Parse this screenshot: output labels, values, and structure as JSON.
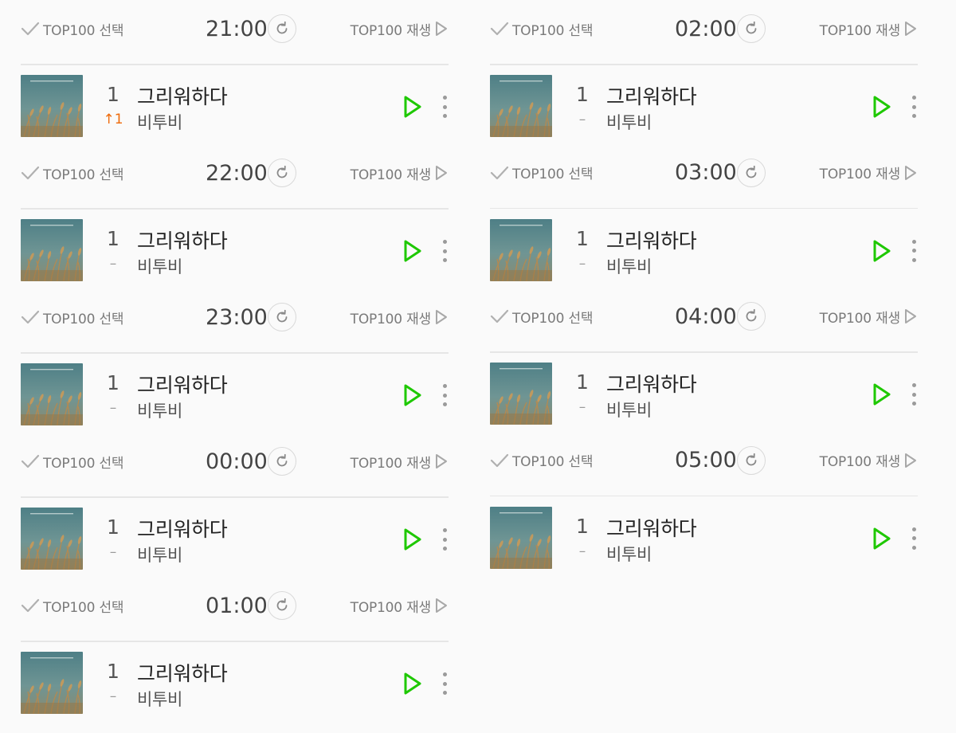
{
  "labels": {
    "select": "TOP100 선택",
    "play_all": "TOP100 재생"
  },
  "icons": {
    "check": "check-icon",
    "refresh": "refresh-icon",
    "play_outline": "play-outline-icon",
    "play": "play-icon",
    "more": "more-vertical-icon"
  },
  "colors": {
    "play_green": "#1ec800",
    "rank_up": "#ee6b0b",
    "muted": "#9a9a9a"
  },
  "left_column": [
    {
      "time": "21:00",
      "rank": "1",
      "rank_change": "↑1",
      "rank_change_type": "up",
      "title": "그리워하다",
      "artist": "비투비"
    },
    {
      "time": "22:00",
      "rank": "1",
      "rank_change": "–",
      "rank_change_type": "same",
      "title": "그리워하다",
      "artist": "비투비"
    },
    {
      "time": "23:00",
      "rank": "1",
      "rank_change": "–",
      "rank_change_type": "same",
      "title": "그리워하다",
      "artist": "비투비"
    },
    {
      "time": "00:00",
      "rank": "1",
      "rank_change": "–",
      "rank_change_type": "same",
      "title": "그리워하다",
      "artist": "비투비"
    },
    {
      "time": "01:00",
      "rank": "1",
      "rank_change": "–",
      "rank_change_type": "same",
      "title": "그리워하다",
      "artist": "비투비"
    }
  ],
  "right_column": [
    {
      "time": "02:00",
      "rank": "1",
      "rank_change": "–",
      "rank_change_type": "same",
      "title": "그리워하다",
      "artist": "비투비"
    },
    {
      "time": "03:00",
      "rank": "1",
      "rank_change": "–",
      "rank_change_type": "same",
      "title": "그리워하다",
      "artist": "비투비"
    },
    {
      "time": "04:00",
      "rank": "1",
      "rank_change": "–",
      "rank_change_type": "same",
      "title": "그리워하다",
      "artist": "비투비"
    },
    {
      "time": "05:00",
      "rank": "1",
      "rank_change": "–",
      "rank_change_type": "same",
      "title": "그리워하다",
      "artist": "비투비"
    }
  ]
}
